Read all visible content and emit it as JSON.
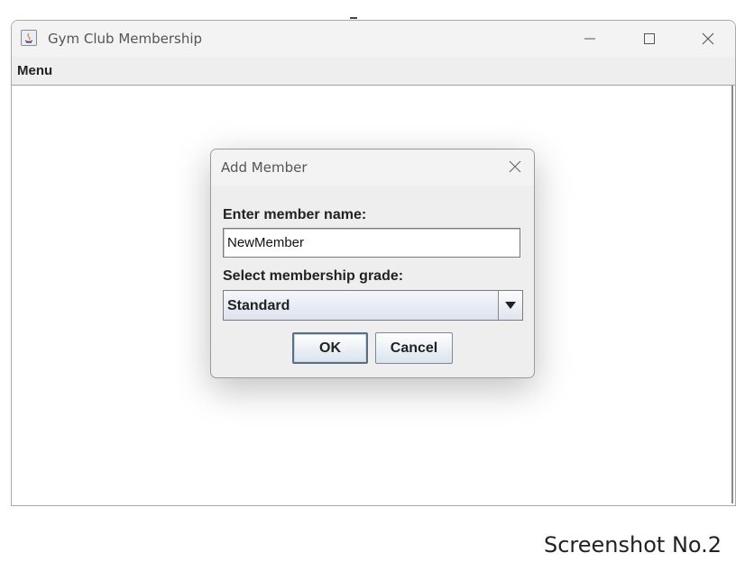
{
  "window": {
    "title": "Gym Club Membership",
    "controls": {
      "minimize_icon": "minimize-icon",
      "maximize_icon": "maximize-icon",
      "close_icon": "close-icon"
    }
  },
  "menubar": {
    "menu_label": "Menu"
  },
  "dialog": {
    "title": "Add Member",
    "name_label": "Enter member name:",
    "name_value": "NewMember",
    "grade_label": "Select membership grade:",
    "grade_selected": "Standard",
    "ok_label": "OK",
    "cancel_label": "Cancel"
  },
  "caption": "Screenshot No.2",
  "colors": {
    "dialog_bg": "#eeeeee",
    "titlebar_bg": "#f3f3f3",
    "button_border": "#5b6e86"
  }
}
